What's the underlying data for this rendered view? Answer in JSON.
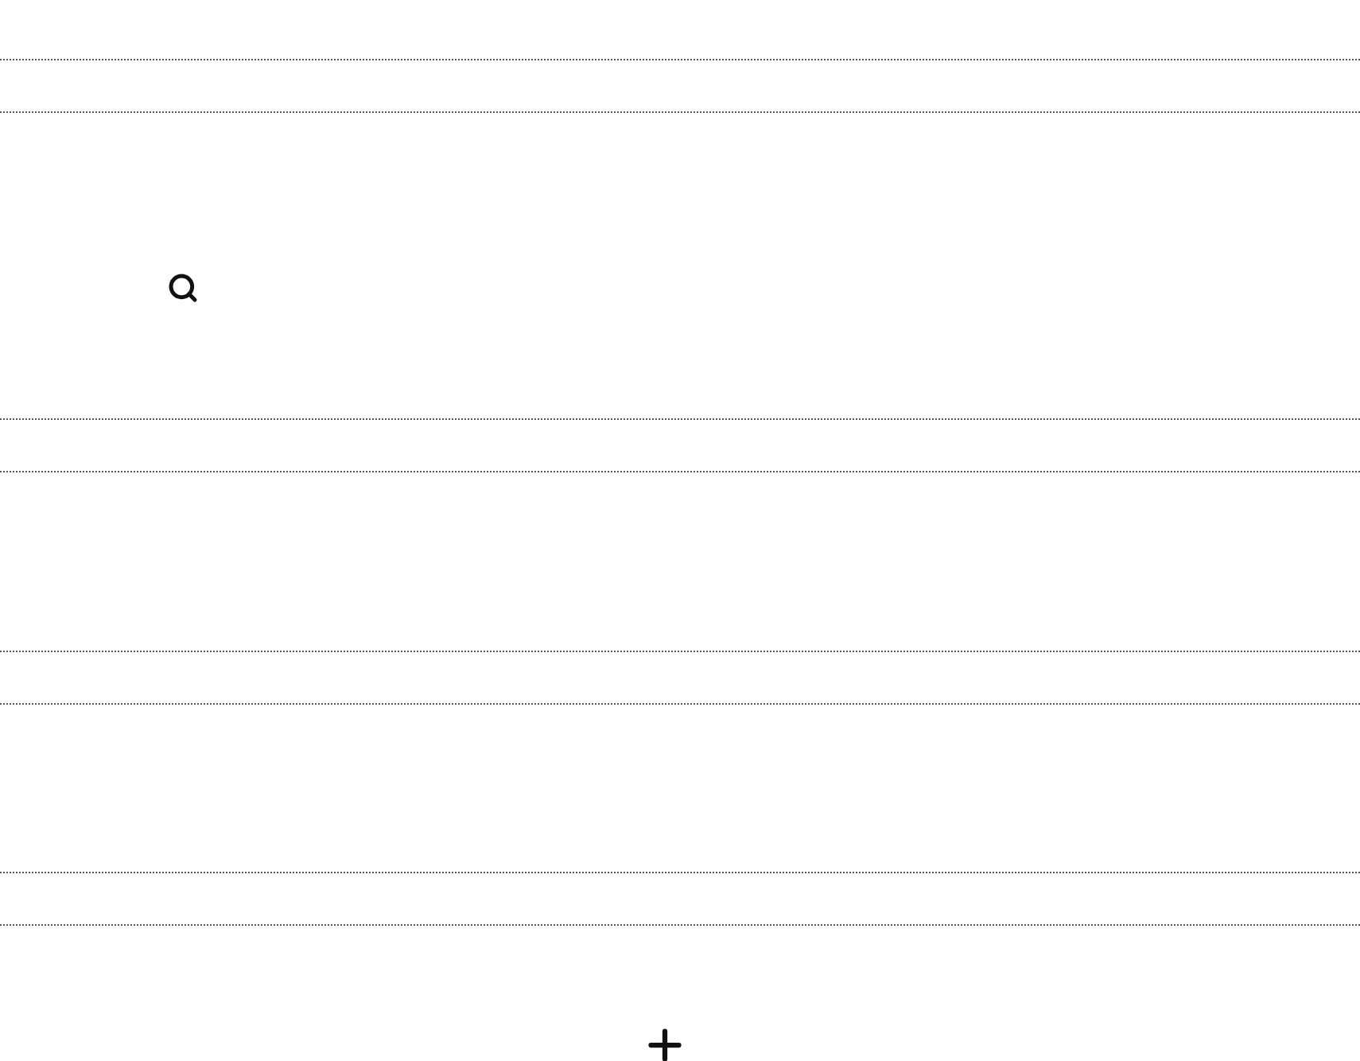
{
  "sections": [
    {
      "kind": "search"
    },
    {
      "kind": "empty"
    },
    {
      "kind": "empty"
    },
    {
      "kind": "add"
    }
  ]
}
